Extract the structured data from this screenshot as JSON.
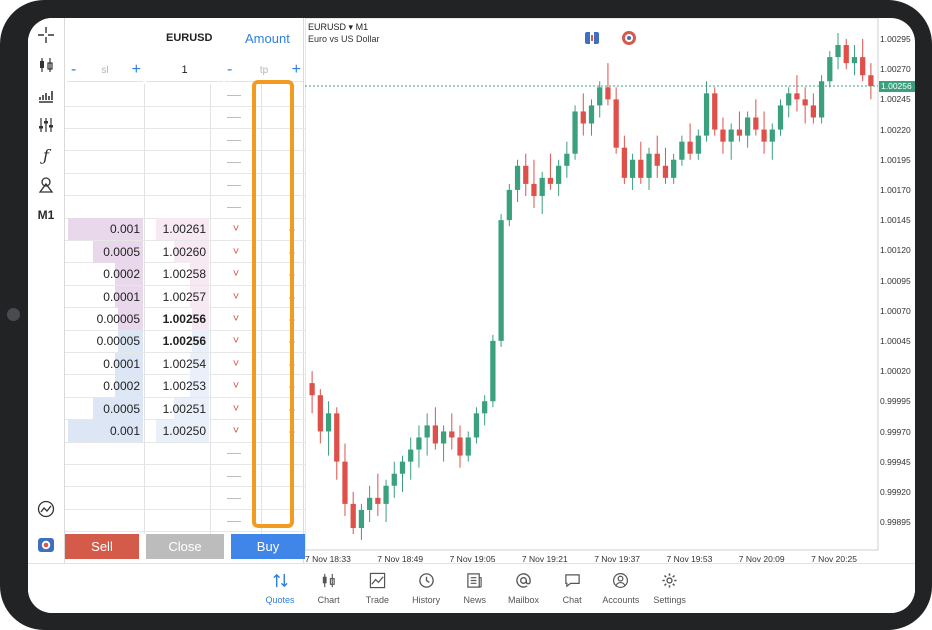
{
  "dom": {
    "symbol": "EURUSD",
    "amount_label": "Amount",
    "sl": {
      "minus": "-",
      "placeholder": "sl",
      "plus": "+"
    },
    "volume": "1",
    "tp": {
      "minus": "-",
      "placeholder": "tp",
      "plus": "+"
    },
    "rows": [
      {
        "volume": "0.001",
        "price": "1.00261",
        "side": "sell",
        "fill": 0.95
      },
      {
        "volume": "0.0005",
        "price": "1.00260",
        "side": "sell",
        "fill": 0.5
      },
      {
        "volume": "0.0002",
        "price": "1.00258",
        "side": "sell",
        "fill": 0.1
      },
      {
        "volume": "0.0001",
        "price": "1.00257",
        "side": "sell",
        "fill": 0.1
      },
      {
        "volume": "0.00005",
        "price": "1.00256",
        "side": "sell",
        "fill": 0.05,
        "bold": true
      },
      {
        "volume": "0.00005",
        "price": "1.00256",
        "side": "buy",
        "fill": 0.05,
        "bold": true
      },
      {
        "volume": "0.0001",
        "price": "1.00254",
        "side": "buy",
        "fill": 0.1
      },
      {
        "volume": "0.0002",
        "price": "1.00253",
        "side": "buy",
        "fill": 0.1
      },
      {
        "volume": "0.0005",
        "price": "1.00251",
        "side": "buy",
        "fill": 0.5
      },
      {
        "volume": "0.001",
        "price": "1.00250",
        "side": "buy",
        "fill": 0.95
      }
    ],
    "sell_arrow": "˅",
    "buy_arrow": "˄",
    "sell_label": "Sell",
    "close_label": "Close",
    "buy_label": "Buy"
  },
  "toolbar": {
    "icons": [
      "crosshair-icon",
      "candles-icon",
      "bars-icon",
      "indicators-icon",
      "function-icon",
      "objects-icon"
    ],
    "timeframe": "M1"
  },
  "chart": {
    "symbol": "EURUSD",
    "dropdown": "▾",
    "timeframe": "M1",
    "description": "Euro vs US Dollar",
    "current_price": "1.00256",
    "y_ticks": [
      "1.00295",
      "1.00270",
      "1.00245",
      "1.00220",
      "1.00195",
      "1.00170",
      "1.00145",
      "1.00120",
      "1.00095",
      "1.00070",
      "1.00045",
      "1.00020",
      "0.99995",
      "0.99970",
      "0.99945",
      "0.99920",
      "0.99895"
    ],
    "x_ticks": [
      "7 Nov 18:33",
      "7 Nov 18:49",
      "7 Nov 19:05",
      "7 Nov 19:21",
      "7 Nov 19:37",
      "7 Nov 19:53",
      "7 Nov 20:09",
      "7 Nov 20:25"
    ]
  },
  "chart_data": {
    "type": "candlestick",
    "title": "EURUSD ▾ M1",
    "subtitle": "Euro vs US Dollar",
    "ylim": [
      0.9988,
      1.00305
    ],
    "up_color": "#3aa07d",
    "down_color": "#e0504a",
    "last_price": 1.00256,
    "candles": [
      [
        1.0001,
        1.0002,
        0.99985,
        1.0
      ],
      [
        1.0,
        1.00005,
        0.9996,
        0.9997
      ],
      [
        0.9997,
        0.99995,
        0.9995,
        0.99985
      ],
      [
        0.99985,
        0.9999,
        0.9993,
        0.99945
      ],
      [
        0.99945,
        0.9996,
        0.999,
        0.9991
      ],
      [
        0.9991,
        0.9992,
        0.99885,
        0.9989
      ],
      [
        0.9989,
        0.9991,
        0.9988,
        0.99905
      ],
      [
        0.99905,
        0.99925,
        0.99895,
        0.99915
      ],
      [
        0.99915,
        0.99935,
        0.999,
        0.9991
      ],
      [
        0.9991,
        0.9993,
        0.99895,
        0.99925
      ],
      [
        0.99925,
        0.99945,
        0.99915,
        0.99935
      ],
      [
        0.99935,
        0.9995,
        0.9992,
        0.99945
      ],
      [
        0.99945,
        0.99965,
        0.9993,
        0.99955
      ],
      [
        0.99955,
        0.99975,
        0.9994,
        0.99965
      ],
      [
        0.99965,
        0.99985,
        0.9995,
        0.99975
      ],
      [
        0.99975,
        0.9999,
        0.99955,
        0.9996
      ],
      [
        0.9996,
        0.99975,
        0.99945,
        0.9997
      ],
      [
        0.9997,
        0.99985,
        0.99955,
        0.99965
      ],
      [
        0.99965,
        0.99975,
        0.9994,
        0.9995
      ],
      [
        0.9995,
        0.9997,
        0.99945,
        0.99965
      ],
      [
        0.99965,
        0.9999,
        0.9996,
        0.99985
      ],
      [
        0.99985,
        1.0,
        0.99975,
        0.99995
      ],
      [
        0.99995,
        1.0005,
        0.9999,
        1.00045
      ],
      [
        1.00045,
        1.0015,
        1.0004,
        1.00145
      ],
      [
        1.00145,
        1.00175,
        1.0014,
        1.0017
      ],
      [
        1.0017,
        1.00195,
        1.0016,
        1.0019
      ],
      [
        1.0019,
        1.002,
        1.00165,
        1.00175
      ],
      [
        1.00175,
        1.00195,
        1.00155,
        1.00165
      ],
      [
        1.00165,
        1.00185,
        1.0015,
        1.0018
      ],
      [
        1.0018,
        1.002,
        1.0017,
        1.00175
      ],
      [
        1.00175,
        1.00195,
        1.00165,
        1.0019
      ],
      [
        1.0019,
        1.0021,
        1.0018,
        1.002
      ],
      [
        1.002,
        1.0024,
        1.00195,
        1.00235
      ],
      [
        1.00235,
        1.0025,
        1.00215,
        1.00225
      ],
      [
        1.00225,
        1.00245,
        1.00215,
        1.0024
      ],
      [
        1.0024,
        1.0026,
        1.0023,
        1.00255
      ],
      [
        1.00255,
        1.00275,
        1.0024,
        1.00245
      ],
      [
        1.00245,
        1.00255,
        1.002,
        1.00205
      ],
      [
        1.00205,
        1.00215,
        1.00175,
        1.0018
      ],
      [
        1.0018,
        1.002,
        1.0017,
        1.00195
      ],
      [
        1.00195,
        1.0021,
        1.00175,
        1.0018
      ],
      [
        1.0018,
        1.00205,
        1.0017,
        1.002
      ],
      [
        1.002,
        1.00215,
        1.0018,
        1.0019
      ],
      [
        1.0019,
        1.00205,
        1.00175,
        1.0018
      ],
      [
        1.0018,
        1.002,
        1.00175,
        1.00195
      ],
      [
        1.00195,
        1.00215,
        1.0019,
        1.0021
      ],
      [
        1.0021,
        1.00225,
        1.00195,
        1.002
      ],
      [
        1.002,
        1.0022,
        1.00195,
        1.00215
      ],
      [
        1.00215,
        1.0026,
        1.0021,
        1.0025
      ],
      [
        1.0025,
        1.00255,
        1.00215,
        1.0022
      ],
      [
        1.0022,
        1.0023,
        1.002,
        1.0021
      ],
      [
        1.0021,
        1.00225,
        1.00195,
        1.0022
      ],
      [
        1.0022,
        1.00235,
        1.0021,
        1.00215
      ],
      [
        1.00215,
        1.00235,
        1.00205,
        1.0023
      ],
      [
        1.0023,
        1.00245,
        1.00215,
        1.0022
      ],
      [
        1.0022,
        1.00235,
        1.002,
        1.0021
      ],
      [
        1.0021,
        1.00225,
        1.00195,
        1.0022
      ],
      [
        1.0022,
        1.00245,
        1.00215,
        1.0024
      ],
      [
        1.0024,
        1.00255,
        1.0023,
        1.0025
      ],
      [
        1.0025,
        1.00265,
        1.00235,
        1.00245
      ],
      [
        1.00245,
        1.00255,
        1.00225,
        1.0024
      ],
      [
        1.0024,
        1.0025,
        1.00225,
        1.0023
      ],
      [
        1.0023,
        1.00265,
        1.00225,
        1.0026
      ],
      [
        1.0026,
        1.00285,
        1.00255,
        1.0028
      ],
      [
        1.0028,
        1.003,
        1.0027,
        1.0029
      ],
      [
        1.0029,
        1.00295,
        1.0027,
        1.00275
      ],
      [
        1.00275,
        1.0029,
        1.00265,
        1.0028
      ],
      [
        1.0028,
        1.00295,
        1.0026,
        1.00265
      ],
      [
        1.00265,
        1.00275,
        1.00245,
        1.00256
      ]
    ]
  },
  "nav": [
    {
      "label": "Quotes",
      "icon": "quotes-icon",
      "active": true
    },
    {
      "label": "Chart",
      "icon": "chart-icon"
    },
    {
      "label": "Trade",
      "icon": "trade-icon"
    },
    {
      "label": "History",
      "icon": "history-icon"
    },
    {
      "label": "News",
      "icon": "news-icon"
    },
    {
      "label": "Mailbox",
      "icon": "mailbox-icon"
    },
    {
      "label": "Chat",
      "icon": "chat-icon"
    },
    {
      "label": "Accounts",
      "icon": "accounts-icon"
    },
    {
      "label": "Settings",
      "icon": "settings-icon"
    }
  ]
}
